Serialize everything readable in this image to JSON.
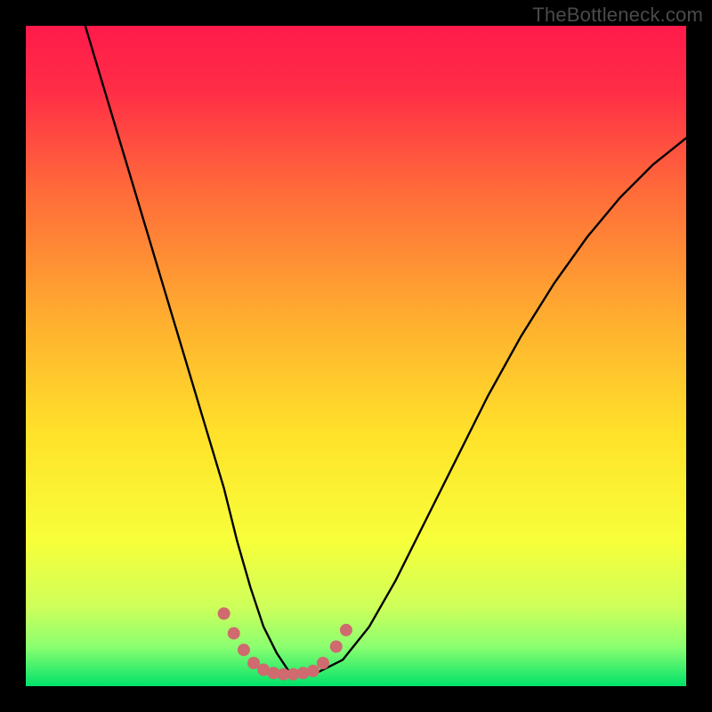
{
  "watermark": "TheBottleneck.com",
  "chart_data": {
    "type": "line",
    "title": "",
    "xlabel": "",
    "ylabel": "",
    "xlim": [
      0,
      100
    ],
    "ylim": [
      0,
      100
    ],
    "grid": false,
    "legend": false,
    "background_gradient": {
      "top_color": "#ff1a4b",
      "mid_color": "#ffe600",
      "bottom_color": "#00e26a",
      "description": "Vertical gradient from red at top through orange and yellow to green at bottom, representing bottleneck severity (red=bad, green=good)."
    },
    "series": [
      {
        "name": "bottleneck-curve",
        "color": "#000000",
        "x": [
          9,
          12,
          15,
          18,
          21,
          24,
          27,
          30,
          32,
          34,
          36,
          38,
          40,
          44,
          48,
          52,
          56,
          60,
          65,
          70,
          75,
          80,
          85,
          90,
          95,
          100
        ],
        "y": [
          100,
          90,
          80,
          70,
          60,
          50,
          40,
          30,
          22,
          15,
          9,
          5,
          2,
          2,
          4,
          9,
          16,
          24,
          34,
          44,
          53,
          61,
          68,
          74,
          79,
          83
        ]
      },
      {
        "name": "optimal-markers",
        "color": "#cf6a6f",
        "marker_only": true,
        "x": [
          30,
          31.5,
          33,
          34.5,
          36,
          37.5,
          39,
          40.5,
          42,
          43.5,
          45,
          47,
          48.5
        ],
        "y": [
          11,
          8,
          5.5,
          3.5,
          2.5,
          2,
          1.8,
          1.8,
          2,
          2.3,
          3.5,
          6,
          8.5
        ]
      }
    ],
    "annotations": []
  }
}
